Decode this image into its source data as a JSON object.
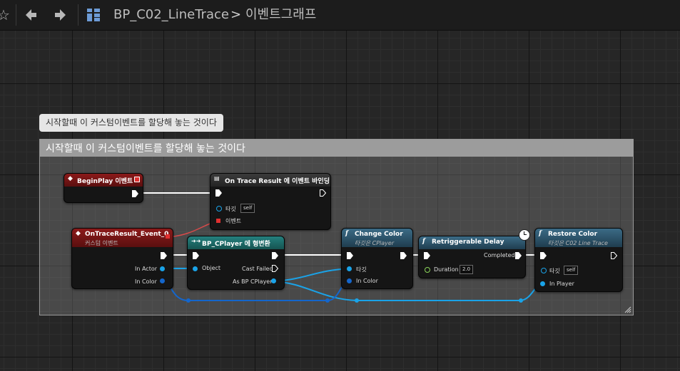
{
  "toolbar": {
    "star_icon": "star-icon",
    "back_icon": "back-arrow-icon",
    "forward_icon": "forward-arrow-icon",
    "blueprint_name": "BP_C02_LineTrace",
    "separator": ">",
    "graph_name": "이벤트그래프"
  },
  "comment": {
    "tooltip": "시작할때 이 커스텀이벤트를 할당해 놓는 것이다",
    "title": "시작할때 이 커스텀이벤트를 할당해 놓는 것이다"
  },
  "nodes": {
    "begin_play": {
      "title": "BeginPlay 이벤트"
    },
    "bind_event": {
      "title": "On Trace Result 에 이벤트 바인딩",
      "target_label": "타깃",
      "target_value": "self",
      "event_label": "이벤트"
    },
    "custom_event": {
      "title": "OnTraceResult_Event_0",
      "subtitle": "커스텀 이벤트",
      "in_actor": "In Actor",
      "in_color": "In Color"
    },
    "cast": {
      "title": "BP_CPlayer 에 형변환",
      "object": "Object",
      "cast_failed": "Cast Failed",
      "as_player": "As BP CPlayer"
    },
    "change_color": {
      "title": "Change Color",
      "subtitle": "타깃은 CPlayer",
      "target_label": "타깃",
      "in_color": "In Color"
    },
    "delay": {
      "title": "Retriggerable Delay",
      "completed": "Completed",
      "duration_label": "Duration",
      "duration_value": "2.0"
    },
    "restore_color": {
      "title": "Restore Color",
      "subtitle": "타깃은 C02 Line Trace",
      "target_label": "타깃",
      "target_value": "self",
      "in_player": "In Player"
    }
  },
  "colors": {
    "event_header": "#7a1414",
    "pure_func_header": "#2c4f63",
    "cast_header": "#1f6b6b",
    "exec_wire": "#ffffff",
    "object_wire": "#1aa3e8",
    "color_wire": "#1466cc",
    "delegate_wire": "#d94a4a"
  }
}
